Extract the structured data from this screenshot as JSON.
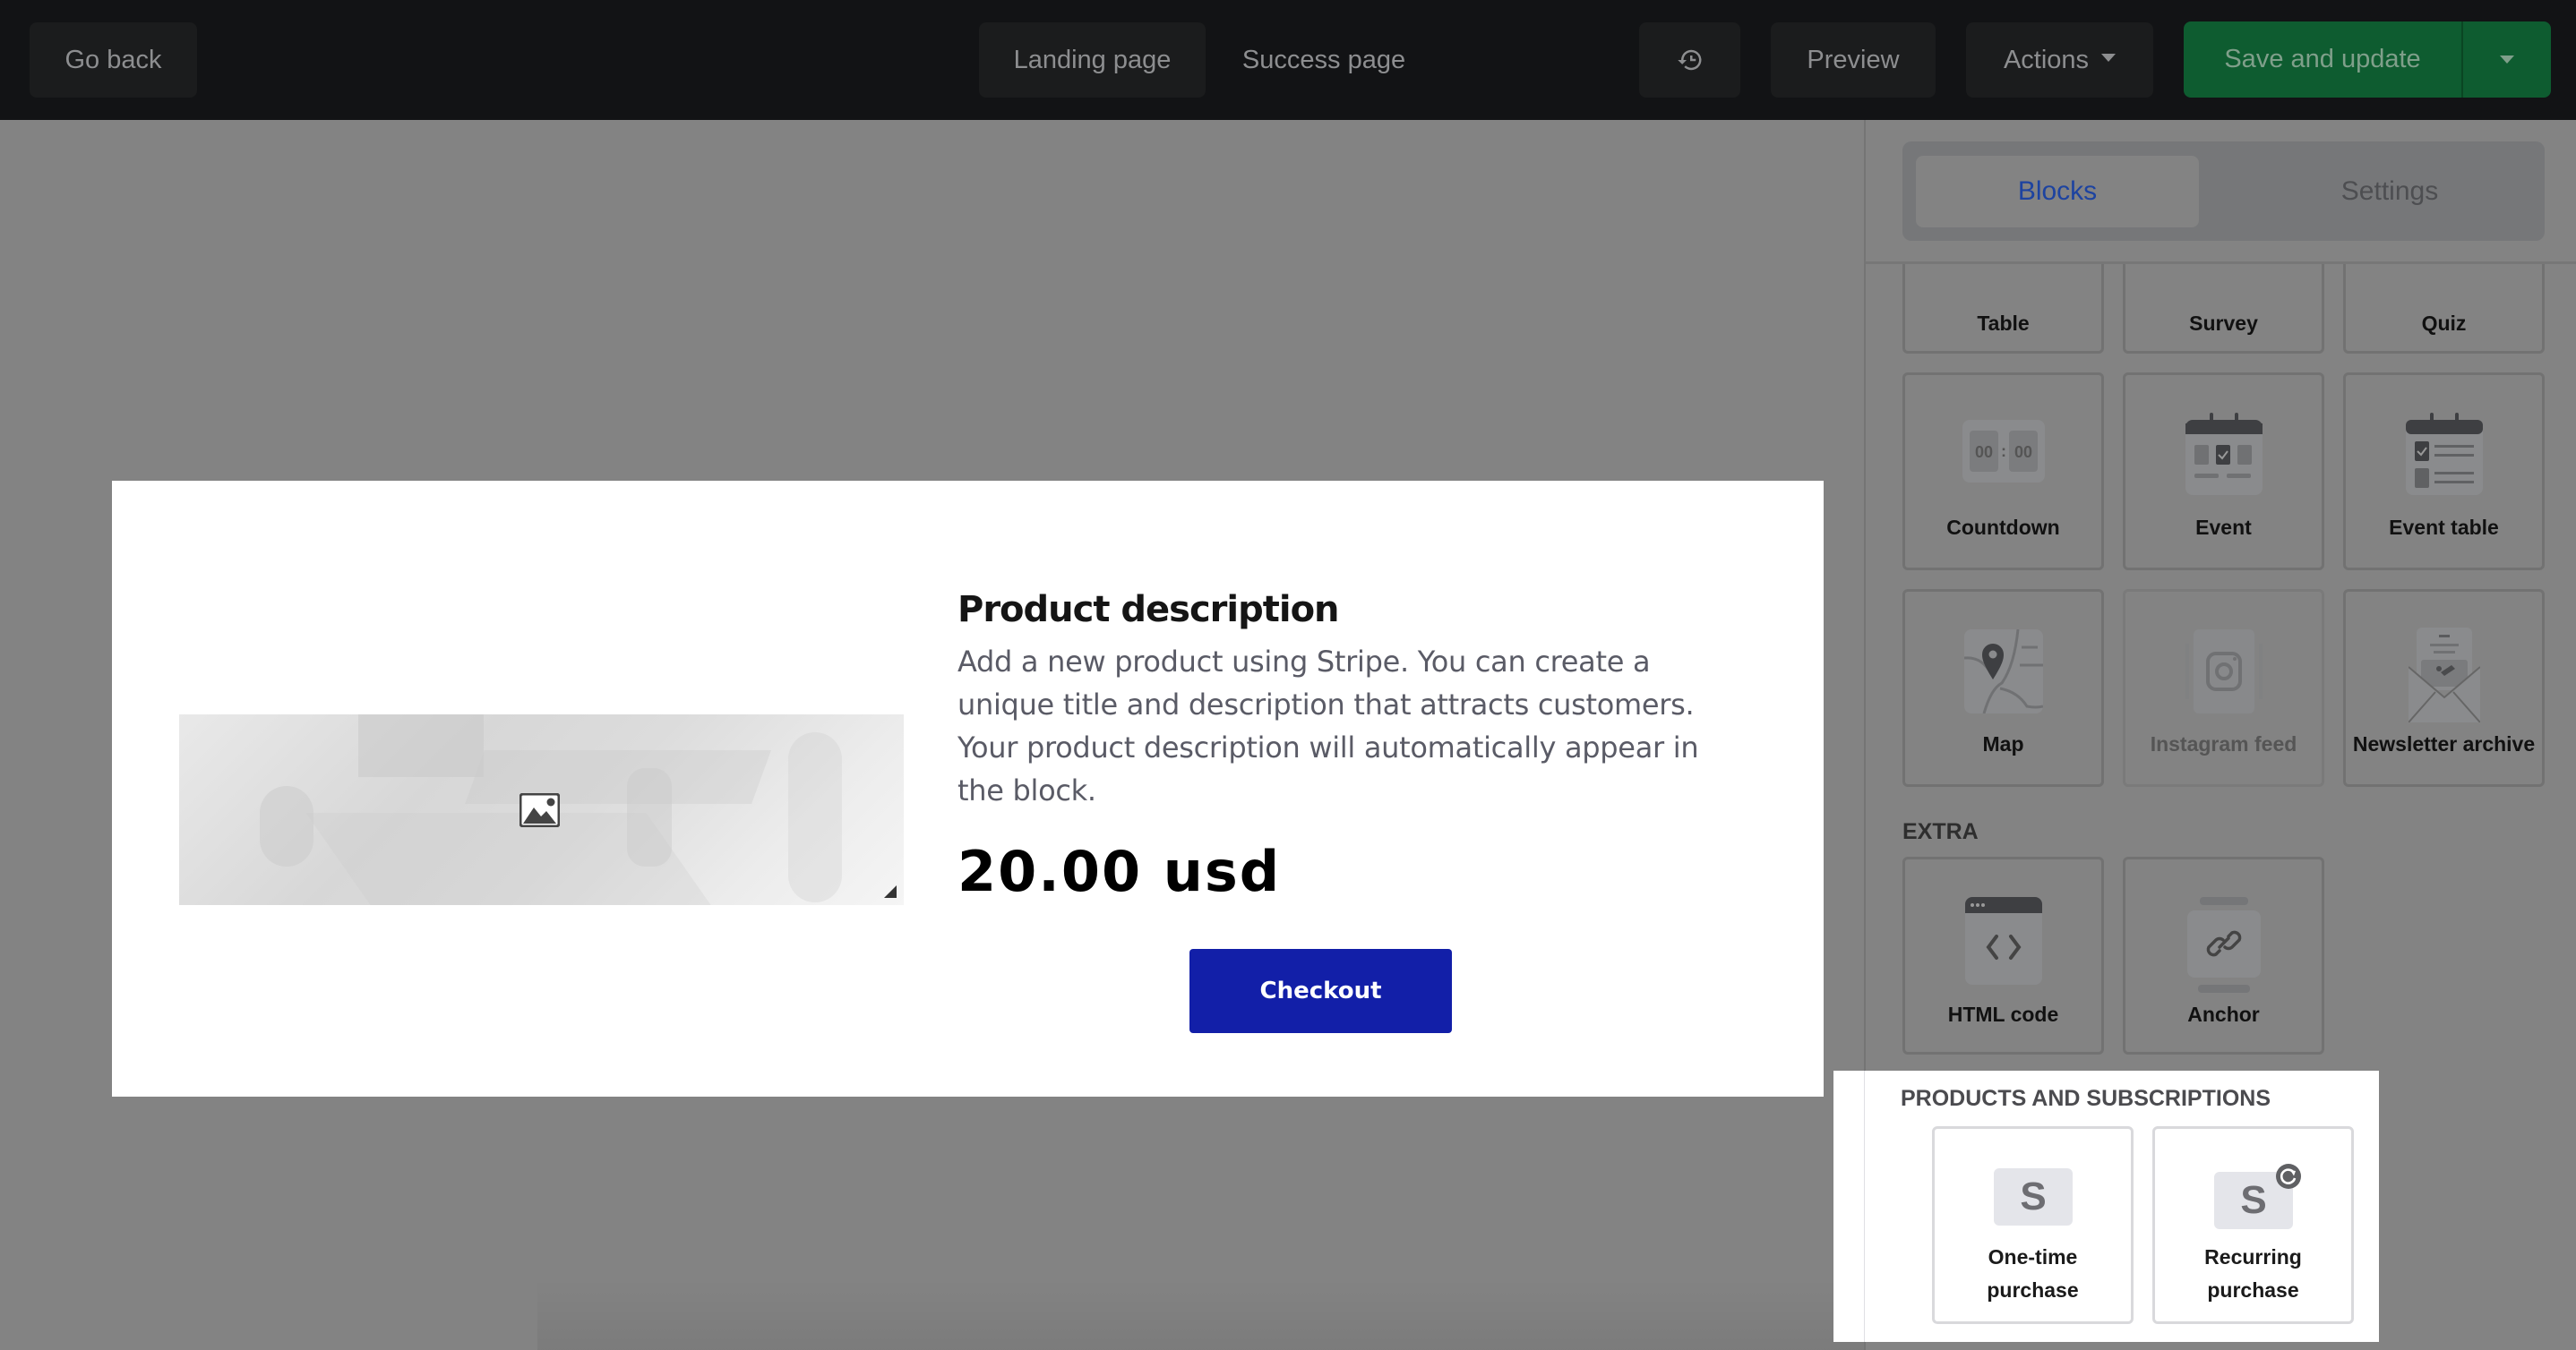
{
  "topbar": {
    "go_back": "Go back",
    "page_tabs": [
      "Landing page",
      "Success page"
    ],
    "active_page_tab": "Landing page",
    "history_icon": "history-icon",
    "preview": "Preview",
    "actions": "Actions",
    "save_and_update": "Save and update"
  },
  "canvas": {
    "product": {
      "image_placeholder_icon": "image-icon",
      "title": "Product description",
      "description": "Add a new product using Stripe. You can create a unique title and description that attracts customers. Your product description will automatically appear in the block.",
      "price": "20.00 usd",
      "checkout_label": "Checkout",
      "checkout_color": "#121fa8"
    }
  },
  "panel": {
    "tabs": [
      {
        "label": "Blocks",
        "active": true
      },
      {
        "label": "Settings",
        "active": false
      }
    ],
    "blocks": [
      {
        "label": "Table",
        "icon": "table-icon"
      },
      {
        "label": "Survey",
        "icon": "survey-icon"
      },
      {
        "label": "Quiz",
        "icon": "quiz-icon"
      },
      {
        "label": "Countdown",
        "icon": "countdown-icon",
        "icon_text": "00 : 00"
      },
      {
        "label": "Event",
        "icon": "calendar-event-icon"
      },
      {
        "label": "Event table",
        "icon": "calendar-list-icon"
      },
      {
        "label": "Map",
        "icon": "map-pin-icon"
      },
      {
        "label": "Instagram feed",
        "icon": "instagram-icon",
        "disabled": true
      },
      {
        "label": "Newsletter archive",
        "icon": "envelope-icon"
      }
    ],
    "extra": {
      "heading": "EXTRA",
      "items": [
        {
          "label": "HTML code",
          "icon": "code-icon"
        },
        {
          "label": "Anchor",
          "icon": "anchor-link-icon"
        }
      ]
    },
    "products": {
      "heading": "PRODUCTS AND SUBSCRIPTIONS",
      "items": [
        {
          "label_line1": "One-time",
          "label_line2": "purchase",
          "icon": "stripe-s-icon",
          "glyph": "S"
        },
        {
          "label_line1": "Recurring",
          "label_line2": "purchase",
          "icon": "stripe-recurring-icon",
          "glyph": "S"
        }
      ]
    }
  },
  "colors": {
    "topbar_bg": "#121315",
    "save_green": "#0e5c30",
    "active_tab_text": "#1d43a0",
    "overlay_gray": "#838383"
  }
}
